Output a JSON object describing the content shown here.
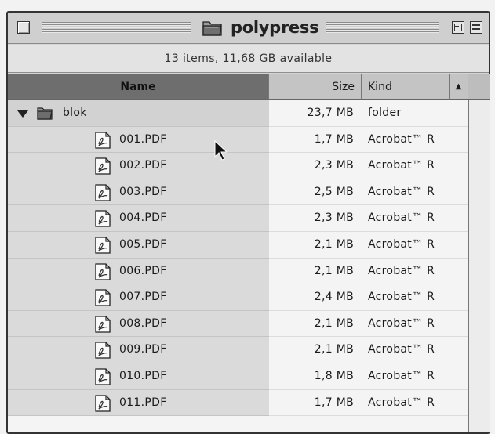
{
  "window": {
    "title": "polypress",
    "status": "13 items, 11,68 GB available"
  },
  "columns": {
    "name": "Name",
    "size": "Size",
    "kind": "Kind"
  },
  "folder": {
    "name": "blok",
    "size": "23,7 MB",
    "kind": "folder",
    "expanded": true
  },
  "files": [
    {
      "name": "001.PDF",
      "size": "1,7 MB",
      "kind": "Acrobat™ R"
    },
    {
      "name": "002.PDF",
      "size": "2,3 MB",
      "kind": "Acrobat™ R"
    },
    {
      "name": "003.PDF",
      "size": "2,5 MB",
      "kind": "Acrobat™ R"
    },
    {
      "name": "004.PDF",
      "size": "2,3 MB",
      "kind": "Acrobat™ R"
    },
    {
      "name": "005.PDF",
      "size": "2,1 MB",
      "kind": "Acrobat™ R"
    },
    {
      "name": "006.PDF",
      "size": "2,1 MB",
      "kind": "Acrobat™ R"
    },
    {
      "name": "007.PDF",
      "size": "2,4 MB",
      "kind": "Acrobat™ R"
    },
    {
      "name": "008.PDF",
      "size": "2,1 MB",
      "kind": "Acrobat™ R"
    },
    {
      "name": "009.PDF",
      "size": "2,1 MB",
      "kind": "Acrobat™ R"
    },
    {
      "name": "010.PDF",
      "size": "1,8 MB",
      "kind": "Acrobat™ R"
    },
    {
      "name": "011.PDF",
      "size": "1,7 MB",
      "kind": "Acrobat™ R"
    }
  ],
  "icons": {
    "close": "close-box-icon",
    "zoom": "zoom-box-icon",
    "collapse": "collapse-box-icon",
    "folder": "folder-icon",
    "document": "pdf-document-icon",
    "disclosure": "disclosure-triangle-icon",
    "sort": "sort-direction-icon",
    "cursor": "arrow-cursor-icon"
  }
}
